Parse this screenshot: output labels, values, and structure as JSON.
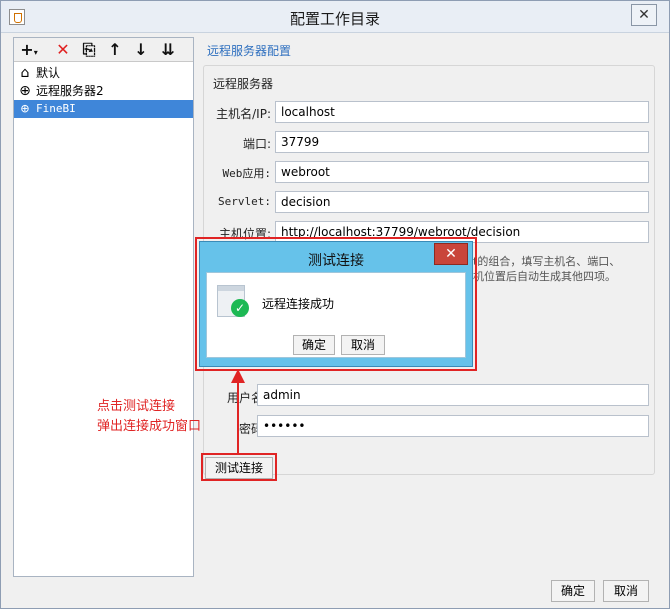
{
  "window": {
    "title": "配置工作目录",
    "close_label": "✕"
  },
  "toolbar": {
    "add_label": "+",
    "add_menu_label": "▾",
    "delete_label": "✕",
    "copy_label": "⎘",
    "up_label": "↑",
    "down_label": "↓",
    "sort_label": "⇊"
  },
  "tree": {
    "items": [
      {
        "label": "默认",
        "icon": "home-icon",
        "glyph": "⌂"
      },
      {
        "label": "远程服务器2",
        "icon": "globe-icon",
        "glyph": "⊕"
      },
      {
        "label": "FineBI",
        "icon": "globe-icon",
        "glyph": "⊕"
      }
    ]
  },
  "config": {
    "section_title": "远程服务器配置",
    "group_title": "远程服务器",
    "host_label": "主机名/IP:",
    "host_value": "localhost",
    "port_label": "端口:",
    "port_value": "37799",
    "webapp_label": "Web应用:",
    "webapp_value": "webroot",
    "servlet_label": "Servlet:",
    "servlet_value": "decision",
    "location_label": "主机位置:",
    "location_value": "http://localhost:37799/webroot/decision",
    "hint_line1": "t的组合，填写主机名、端口、",
    "hint_line2": "机位置后自动生成其他四项。",
    "username_label": "用户名:",
    "username_value": "admin",
    "password_label": "密码:",
    "password_value": "••••••",
    "test_button": "测试连接"
  },
  "annotation": {
    "line1": "点击测试连接",
    "line2": "弹出连接成功窗口"
  },
  "footer": {
    "ok_label": "确定",
    "cancel_label": "取消"
  },
  "dialog": {
    "title": "测试连接",
    "close_label": "✕",
    "message": "远程连接成功",
    "ok_label": "确定",
    "cancel_label": "取消"
  },
  "colors": {
    "accent": "#3f86d9",
    "dialog_title": "#66c2ea",
    "highlight": "#e02424",
    "success": "#1db954"
  }
}
